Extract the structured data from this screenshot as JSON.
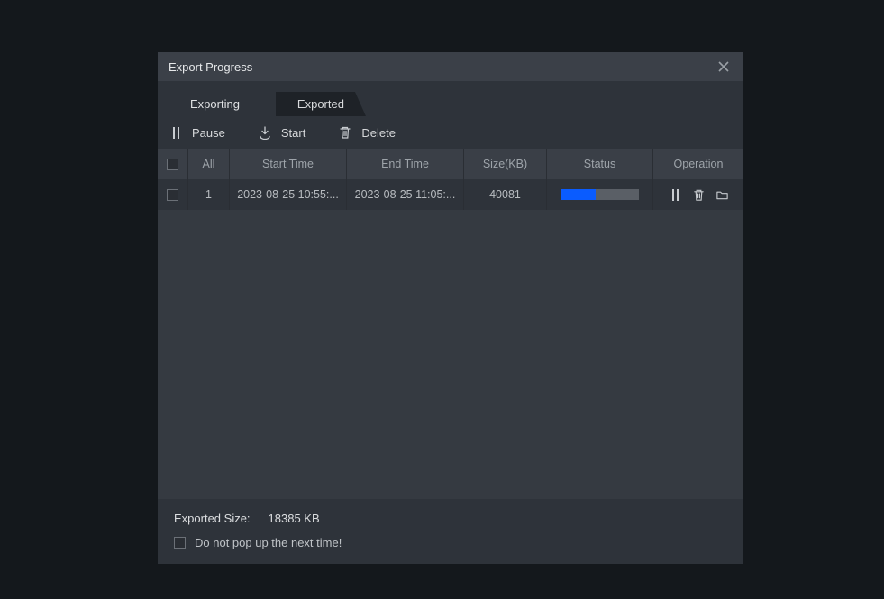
{
  "title": "Export Progress",
  "tabs": {
    "exporting": "Exporting",
    "exported": "Exported"
  },
  "toolbar": {
    "pause": "Pause",
    "start": "Start",
    "delete": "Delete"
  },
  "columns": {
    "all": "All",
    "start_time": "Start Time",
    "end_time": "End Time",
    "size": "Size(KB)",
    "status": "Status",
    "operation": "Operation"
  },
  "rows": [
    {
      "index": "1",
      "start_time": "2023-08-25 10:55:...",
      "end_time": "2023-08-25 11:05:...",
      "size": "40081",
      "progress_pct": 45
    }
  ],
  "footer": {
    "exported_label": "Exported Size:",
    "exported_value": "18385 KB",
    "popup_label": "Do not pop up the next time!"
  }
}
